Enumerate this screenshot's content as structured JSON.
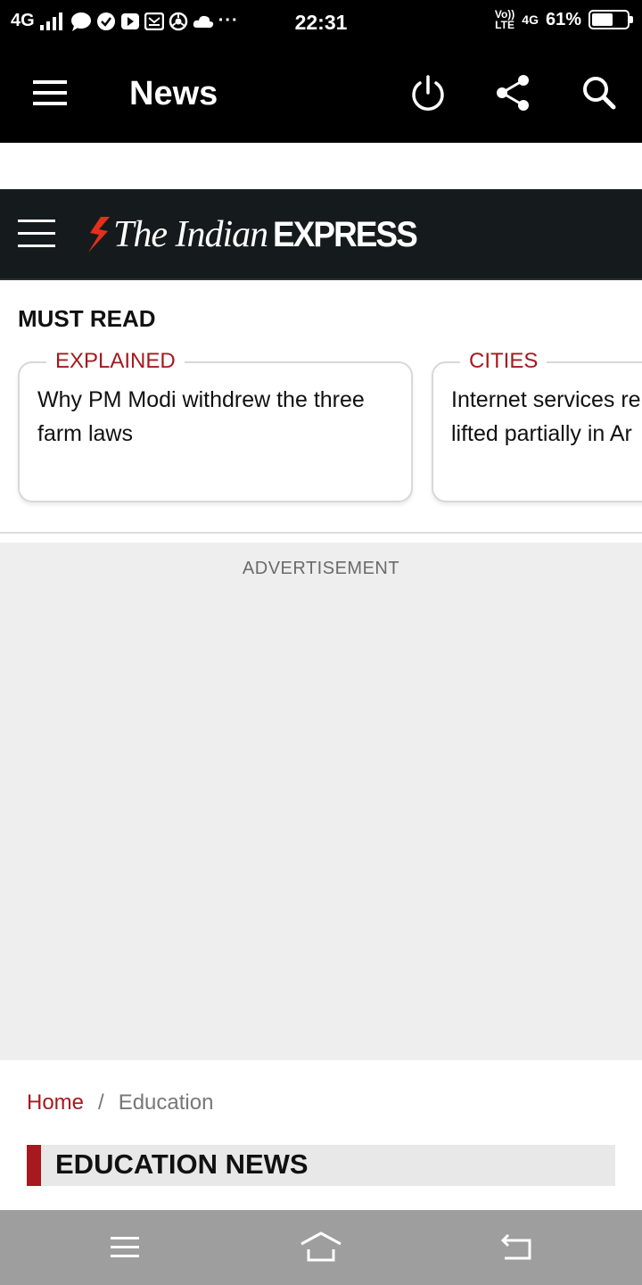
{
  "status_bar": {
    "network": "4G",
    "time": "22:31",
    "volte_top": "Vo))",
    "volte_bottom": "LTE",
    "network_right": "4G",
    "battery_percent": "61%",
    "battery_level": 0.61,
    "notification_icons": [
      "chat-icon",
      "check-icon",
      "youtube-icon",
      "gallery-icon",
      "chrome-icon",
      "cloud-icon"
    ],
    "more": "···"
  },
  "app_bar": {
    "title": "News",
    "actions": [
      "power-icon",
      "share-icon",
      "search-icon"
    ]
  },
  "site_header": {
    "logo_the": "The Indian",
    "logo_express": "EXPRESS",
    "accent_color": "#e3301d"
  },
  "must_read": {
    "title": "MUST READ",
    "cards": [
      {
        "category": "EXPLAINED",
        "line1": "Why PM Modi withdrew the three",
        "line2": "farm laws"
      },
      {
        "category": "CITIES",
        "line1": "Internet services re",
        "line2": "lifted partially in Ar"
      }
    ]
  },
  "advertisement": {
    "label": "ADVERTISEMENT"
  },
  "breadcrumb": {
    "home": "Home",
    "separator": "/",
    "current": "Education"
  },
  "section": {
    "title": "EDUCATION NEWS"
  },
  "colors": {
    "brand_red": "#a5191f",
    "header_dark": "#151b1c"
  },
  "nav_bar": {
    "buttons": [
      "menu-icon",
      "home-icon",
      "back-icon"
    ]
  }
}
